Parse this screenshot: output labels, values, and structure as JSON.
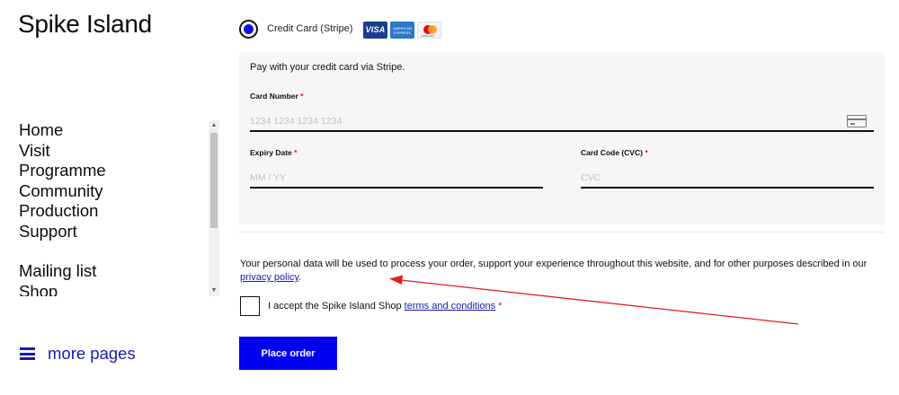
{
  "site": {
    "title": "Spike Island"
  },
  "nav": {
    "primary": [
      "Home",
      "Visit",
      "Programme",
      "Community",
      "Production",
      "Support"
    ],
    "secondary": [
      "Mailing list",
      "Shop"
    ],
    "more_pages": "more pages"
  },
  "payment": {
    "method_label": "Credit Card (Stripe)",
    "card_logos": {
      "visa": "VISA",
      "amex": "AMERICAN EXPRESS",
      "mastercard": "mastercard"
    },
    "description": "Pay with your credit card via Stripe.",
    "card_number": {
      "label": "Card Number",
      "placeholder": "1234 1234 1234 1234"
    },
    "expiry": {
      "label": "Expiry Date",
      "placeholder": "MM / YY"
    },
    "cvc": {
      "label": "Card Code (CVC)",
      "placeholder": "CVC"
    },
    "required_mark": "*"
  },
  "privacy": {
    "text": "Your personal data will be used to process your order, support your experience throughout this website, and for other purposes described in our",
    "link": "privacy policy",
    "end": "."
  },
  "terms": {
    "text": "I accept the Spike Island Shop",
    "link": "terms and conditions",
    "required_mark": "*"
  },
  "place_order": "Place order",
  "colors": {
    "accent": "#0000f0",
    "link": "#1a1ab0",
    "required": "#d42020",
    "annotation_arrow": "#e02020"
  }
}
